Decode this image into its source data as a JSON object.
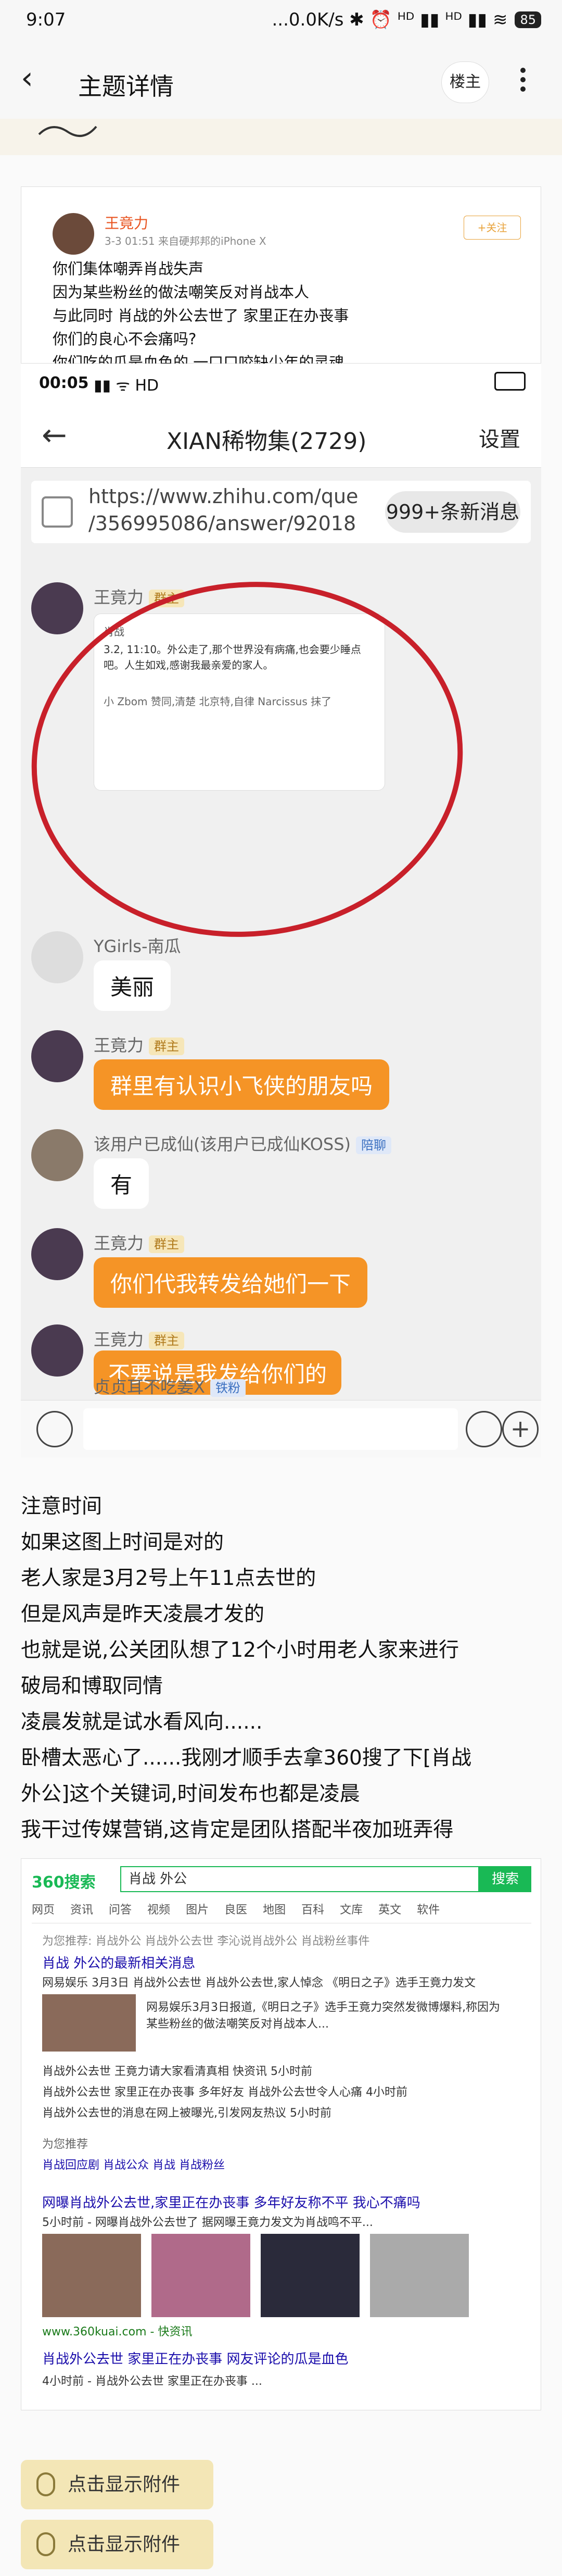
{
  "status_bar": {
    "time": "9:07",
    "indicators": "...0.0K/s ✱ ⏰ ᴴᴰ ▮▮ ᴴᴰ ▮▮ ≋",
    "battery": "85"
  },
  "app_bar": {
    "title": "主题详情",
    "owner_button": "楼主"
  },
  "weibo": {
    "name": "王竟力",
    "meta": "3-3 01:51 来自硬邦邦的iPhone X",
    "follow": "+关注",
    "lines": [
      "你们集体嘲弄肖战失声",
      "因为某些粉丝的做法嘲笑反对肖战本人",
      "与此同时 肖战的外公去世了 家里正在办丧事",
      "你们的良心不会痛吗?",
      "你们吃的瓜是血色的 一口口咬缺少年的灵魂"
    ]
  },
  "phone": {
    "time": "00:05",
    "icons": "▮▮ ᯤ HD",
    "chat_title": "XIAN稀物集(2729)",
    "settings": "设置",
    "link_line1": "https://www.zhihu.com/que",
    "link_line2": "/356995086/answer/92018",
    "new_messages": "999+条新消息",
    "embed_title": "肖战",
    "embed_text": "3.2, 11:10。外公走了,那个世界没有病痛,也会要少睡点吧。人生如戏,感谢我最亲爱的家人。",
    "embed_comments": "小 Zbom 赞同,清楚 北京特,自律 Narcissus 抹了",
    "messages": [
      {
        "name": "王竟力",
        "tag": "群主",
        "text": ""
      },
      {
        "name": "YGirls-南瓜",
        "tag": "",
        "text": "美丽"
      },
      {
        "name": "王竟力",
        "tag": "群主",
        "text": "群里有认识小飞侠的朋友吗"
      },
      {
        "name": "该用户已成仙(该用户已成仙KOSS)",
        "tag": "陪聊",
        "text": "有"
      },
      {
        "name": "王竟力",
        "tag": "群主",
        "text": "你们代我转发给她们一下"
      },
      {
        "name": "王竟力",
        "tag": "群主",
        "text": "不要说是我发给你们的"
      },
      {
        "name": "贞贞耳不吃姜X",
        "tag": "铁粉",
        "text": ""
      }
    ]
  },
  "body_text": [
    "注意时间",
    "如果这图上时间是对的",
    "老人家是3月2号上午11点去世的",
    "但是风声是昨天凌晨才发的",
    "也就是说,公关团队想了12个小时用老人家来进行",
    "破局和博取同情",
    "凌晨发就是试水看风向......",
    "卧槽太恶心了......我刚才顺手去拿360搜了下[肖战",
    "外公]这个关键词,时间发布也都是凌晨",
    "我干过传媒营销,这肯定是团队搭配半夜加班弄得"
  ],
  "search": {
    "logo": "360搜索",
    "query": "肖战 外公",
    "button": "搜索",
    "tabs": [
      "网页",
      "资讯",
      "问答",
      "视频",
      "图片",
      "良医",
      "地图",
      "百科",
      "文库",
      "英文",
      "软件"
    ],
    "rows": [
      "为您推荐:  肖战外公  肖战外公去世  李沁说肖战外公  肖战粉丝事件",
      "肖战 外公的最新相关消息",
      "网易娱乐 3月3日 肖战外公去世  肖战外公去世,家人悼念 《明日之子》选手王竟力发文",
      "网易娱乐3月3日报道,《明日之子》选手王竟力突然发微博爆料,称因为某些粉丝的做法嘲笑反对肖战本人...",
      "肖战外公去世 王竟力请大家看清真相 快资讯  5小时前",
      "肖战外公去世 家里正在办丧事 多年好友 肖战外公去世令人心痛  4小时前",
      "肖战外公去世的消息在网上被曝光,引发网友热议  5小时前",
      "为您推荐",
      "肖战回应剧  肖战公众  肖战  肖战粉丝",
      "网曝肖战外公去世,家里正在办丧事 多年好友称不平 我心不痛吗",
      "5小时前 - 网曝肖战外公去世了 据网曝王竟力发文为肖战鸣不平...",
      "www.360kuai.com  - 快资讯",
      "肖战外公去世 家里正在办丧事 网友评论的瓜是血色",
      "4小时前 - 肖战外公去世 家里正在办丧事 ..."
    ]
  },
  "attachments": [
    "点击显示附件",
    "点击显示附件"
  ]
}
